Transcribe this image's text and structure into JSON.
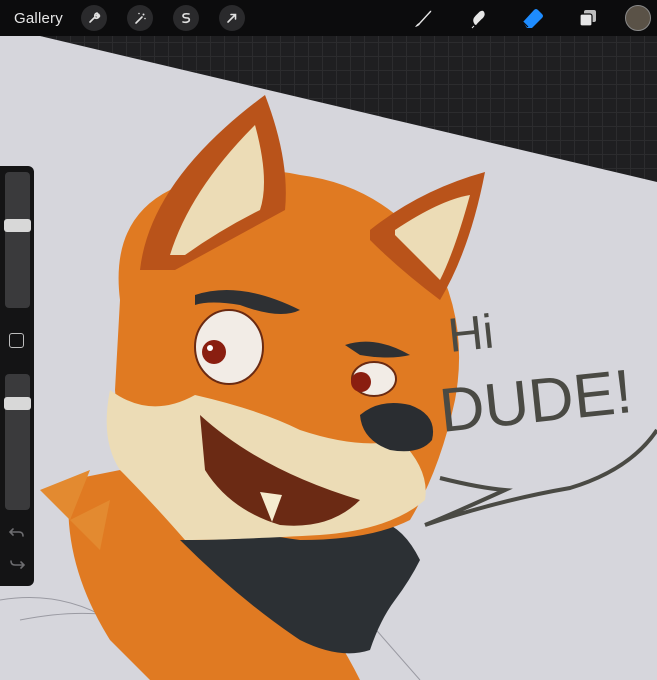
{
  "topbar": {
    "gallery_label": "Gallery",
    "left_tools": [
      "wrench-icon",
      "magic-wand-icon",
      "selection-icon",
      "transform-arrow-icon"
    ],
    "right_tools": [
      "brush-icon",
      "smudge-icon",
      "eraser-icon",
      "layers-icon"
    ],
    "active_tool": "eraser-icon",
    "accent_color": "#1e8cff",
    "current_color": "#5a5247"
  },
  "sidebar": {
    "brush_size": 0.62,
    "brush_opacity": 0.81,
    "buttons": [
      "modify-button",
      "undo-icon",
      "redo-icon"
    ]
  },
  "canvas": {
    "paper_color": "#d6d6dc",
    "artwork_text_line1": "Hi",
    "artwork_text_line2": "DUDE!"
  }
}
